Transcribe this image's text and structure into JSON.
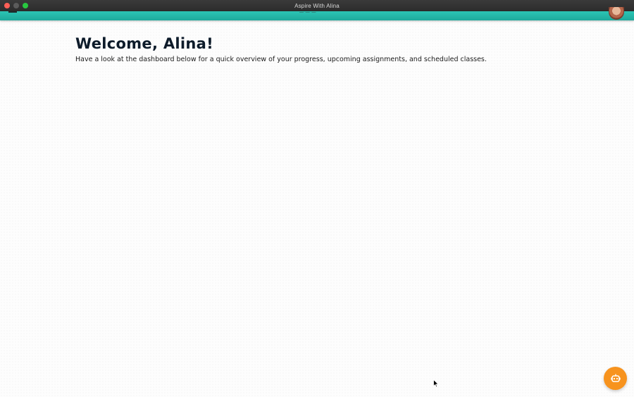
{
  "window": {
    "title": "Aspire With Alina"
  },
  "appbar": {
    "accent_color": "#1eaa9c",
    "nav_partial": "— — —"
  },
  "main": {
    "heading": "Welcome, Alina!",
    "intro": "Have a look at the dashboard below for a quick overview of your progress, upcoming assignments, and scheduled classes."
  },
  "chat_button": {
    "icon": "robot-icon",
    "color": "#f7931e"
  }
}
